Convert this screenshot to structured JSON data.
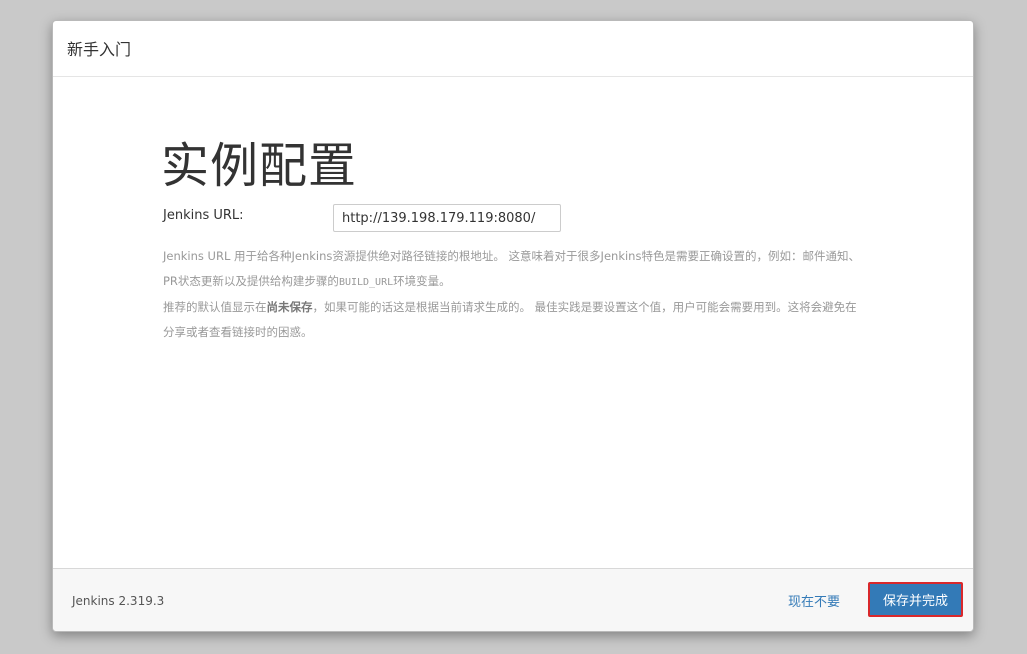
{
  "dialog": {
    "title": "新手入门"
  },
  "main": {
    "heading": "实例配置",
    "url_field": {
      "label": "Jenkins URL:",
      "value": "http://139.198.179.119:8080/"
    },
    "help": {
      "p1_before": "Jenkins URL 用于给各种Jenkins资源提供绝对路径链接的根地址。 这意味着对于很多Jenkins特色是需要正确设置的，例如：邮件通知、PR状态更新以及提供给构建步骤的",
      "p1_code": "BUILD_URL",
      "p1_after": "环境变量。",
      "p2_before": "推荐的默认值显示在",
      "p2_strong": "尚未保存",
      "p2_after": "，如果可能的话这是根据当前请求生成的。 最佳实践是要设置这个值，用户可能会需要用到。这将会避免在分享或者查看链接时的困惑。"
    }
  },
  "footer": {
    "version": "Jenkins 2.319.3",
    "skip_label": "现在不要",
    "save_label": "保存并完成"
  },
  "colors": {
    "primary": "#337ab7",
    "highlight_border": "#d9282b"
  }
}
